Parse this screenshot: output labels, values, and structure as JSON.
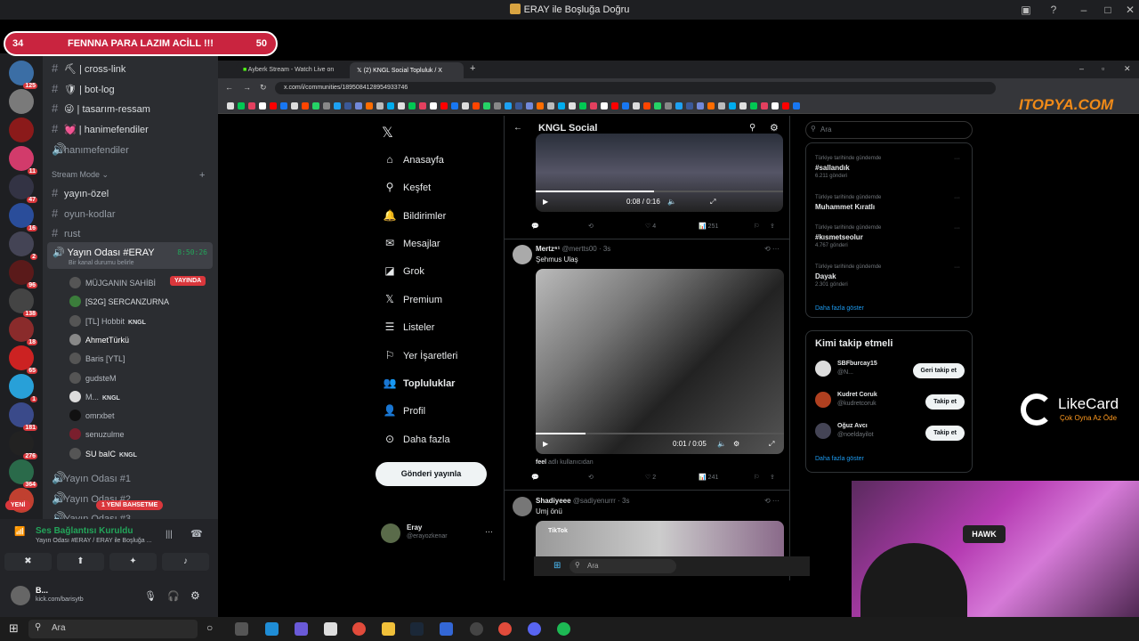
{
  "window": {
    "title": "ERAY ile Boşluğa Doğru"
  },
  "donation": {
    "left": "34",
    "text": "FENNNA PARA LAZIM ACİLL !!!",
    "right": "50"
  },
  "discord": {
    "server_badges": [
      "125",
      "",
      "",
      "11",
      "47",
      "16",
      "2",
      "96",
      "138",
      "18",
      "65",
      "1",
      "181",
      "276",
      "364",
      ""
    ],
    "new_badge": "YENİ",
    "new_game_badge": "1 YENİ BAHSETME",
    "channels_top": [
      {
        "icon": "⛏",
        "label": "cross-link"
      },
      {
        "icon": "🛡",
        "label": "bot-log"
      },
      {
        "icon": "😜",
        "label": "tasarım-ressam"
      },
      {
        "icon": "💓",
        "label": "hanimefendiler"
      }
    ],
    "hanimefendiler_voice": "hanımefendiler",
    "category": "Stream Mode",
    "text_channels": [
      "yayın-özel",
      "oyun-kodlar",
      "rust"
    ],
    "voice_room": {
      "name": "Yayın Odası #ERAY",
      "status": "Bir kanal durumu belirle",
      "timer": "8:50:26"
    },
    "users": [
      {
        "name": "MÜJGANIN SAHİBİ",
        "tag": "YAYINDA"
      },
      {
        "name": "[S2G] SERCANZURNA",
        "tag": ""
      },
      {
        "name": "[TL] Hobbit",
        "tag": "KNGL"
      },
      {
        "name": "AhmetTürkü",
        "tag": ""
      },
      {
        "name": "Baris [YTL]",
        "tag": ""
      },
      {
        "name": "gudsteM",
        "tag": ""
      },
      {
        "name": "M...",
        "tag": "KNGL"
      },
      {
        "name": "omrxbet",
        "tag": ""
      },
      {
        "name": "senuzulme",
        "tag": ""
      },
      {
        "name": "SU baIC",
        "tag": "KNGL"
      }
    ],
    "other_rooms": [
      "Yayın Odası #1",
      "Yayın Odası #2",
      "Yayın Odası #3"
    ],
    "voice_panel": {
      "status": "Ses Bağlantısı Kuruldu",
      "detail": "Yayın Odası #ERAY / ERAY ile Boşluğa ..."
    },
    "me": {
      "name": "B...",
      "sub": "kick.com/barisytb"
    }
  },
  "browser": {
    "tabs": [
      "Ayberk Stream - Watch Live on",
      "(2) KNGL Social Topluluk / X"
    ],
    "url": "x.com/i/communities/1895084128954933746",
    "watermark": "ITOPYA.COM"
  },
  "x": {
    "nav": [
      "Anasayfa",
      "Keşfet",
      "Bildirimler",
      "Mesajlar",
      "Grok",
      "Premium",
      "Listeler",
      "Yer İşaretleri",
      "Topluluklar",
      "Profil",
      "Daha fazla"
    ],
    "post_button": "Gönderi yayınla",
    "account": {
      "name": "Eray",
      "handle": "@erayozkenar"
    },
    "feed_title": "KNGL Social",
    "post1": {
      "time": "0:08 / 0:16",
      "likes": "4",
      "views": "251"
    },
    "post2": {
      "name": "Mertz⁶¹",
      "handle": "@mertts00 · 3s",
      "text": "Şehmus Ulaş",
      "time": "0:01 / 0:05",
      "likes": "2",
      "views": "241",
      "footer": "feel",
      "footer_rest": "adlı kullanıcıdan"
    },
    "post3": {
      "name": "Shadiyeee",
      "handle": "@sadiyenurrr · 3s",
      "text": "Umj önü",
      "badge": "TikTok"
    },
    "search_placeholder": "Ara",
    "trends": [
      {
        "ctx": "Türkiye tarihinde gündemde",
        "name": "#sallandık",
        "count": "6.211 gönderi"
      },
      {
        "ctx": "Türkiye tarihinde gündemde",
        "name": "Muhammet Kıratlı",
        "count": ""
      },
      {
        "ctx": "Türkiye tarihinde gündemde",
        "name": "#kısmetseolur",
        "count": "4.767 gönderi"
      },
      {
        "ctx": "Türkiye tarihinde gündemde",
        "name": "Dayak",
        "count": "2.301 gönderi"
      }
    ],
    "show_more": "Daha fazla göster",
    "who_to_follow": "Kimi takip etmeli",
    "follows": [
      {
        "name": "SBFburcay15",
        "handle": "@N...",
        "btn": "Geri takip et"
      },
      {
        "name": "Kudret Coruk",
        "handle": "@kudretcoruk",
        "btn": "Takip et"
      },
      {
        "name": "Oğuz Avcı",
        "handle": "@noeldayilot",
        "btn": "Takip et"
      }
    ],
    "show_more2": "Daha fazla göster"
  },
  "inner_taskbar": {
    "search": "Ara"
  },
  "likecard": {
    "name": "LikeCard",
    "tagline": "Çok Oyna Az Öde"
  },
  "webcam": {
    "brand": "HAWK"
  },
  "taskbar": {
    "search": "Ara"
  }
}
